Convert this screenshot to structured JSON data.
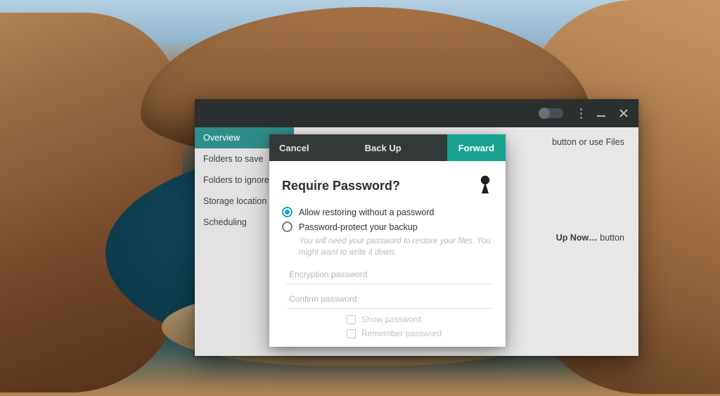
{
  "sidebar": {
    "items": [
      {
        "label": "Overview"
      },
      {
        "label": "Folders to save"
      },
      {
        "label": "Folders to ignore"
      },
      {
        "label": "Storage location"
      },
      {
        "label": "Scheduling"
      }
    ]
  },
  "content": {
    "peek_line1": "button or use Files",
    "peek_line2_pre": "",
    "peek_line2_bold": "Up Now…",
    "peek_line2_post": " button"
  },
  "dialog": {
    "cancel_label": "Cancel",
    "title": "Back Up",
    "forward_label": "Forward",
    "heading": "Require Password?",
    "option_allow": "Allow restoring without a password",
    "option_protect": "Password-protect your backup",
    "hint": "You will need your password to restore your files. You might want to write it down.",
    "encryption_placeholder": "Encryption password",
    "confirm_placeholder": "Confirm password",
    "show_password_label": "Show password",
    "remember_password_label": "Remember password"
  },
  "icons": {
    "keyhole": "keyhole-icon",
    "menu_dots": "menu-dots-icon",
    "minimize": "minimize-icon",
    "close": "close-icon",
    "toggle": "toggle-switch"
  },
  "colors": {
    "accent_teal": "#18a28f",
    "sidebar_active": "#2f8d8a",
    "radio_active": "#16a0d0",
    "titlebar": "#2c2f30",
    "dialog_header": "#34393a"
  }
}
